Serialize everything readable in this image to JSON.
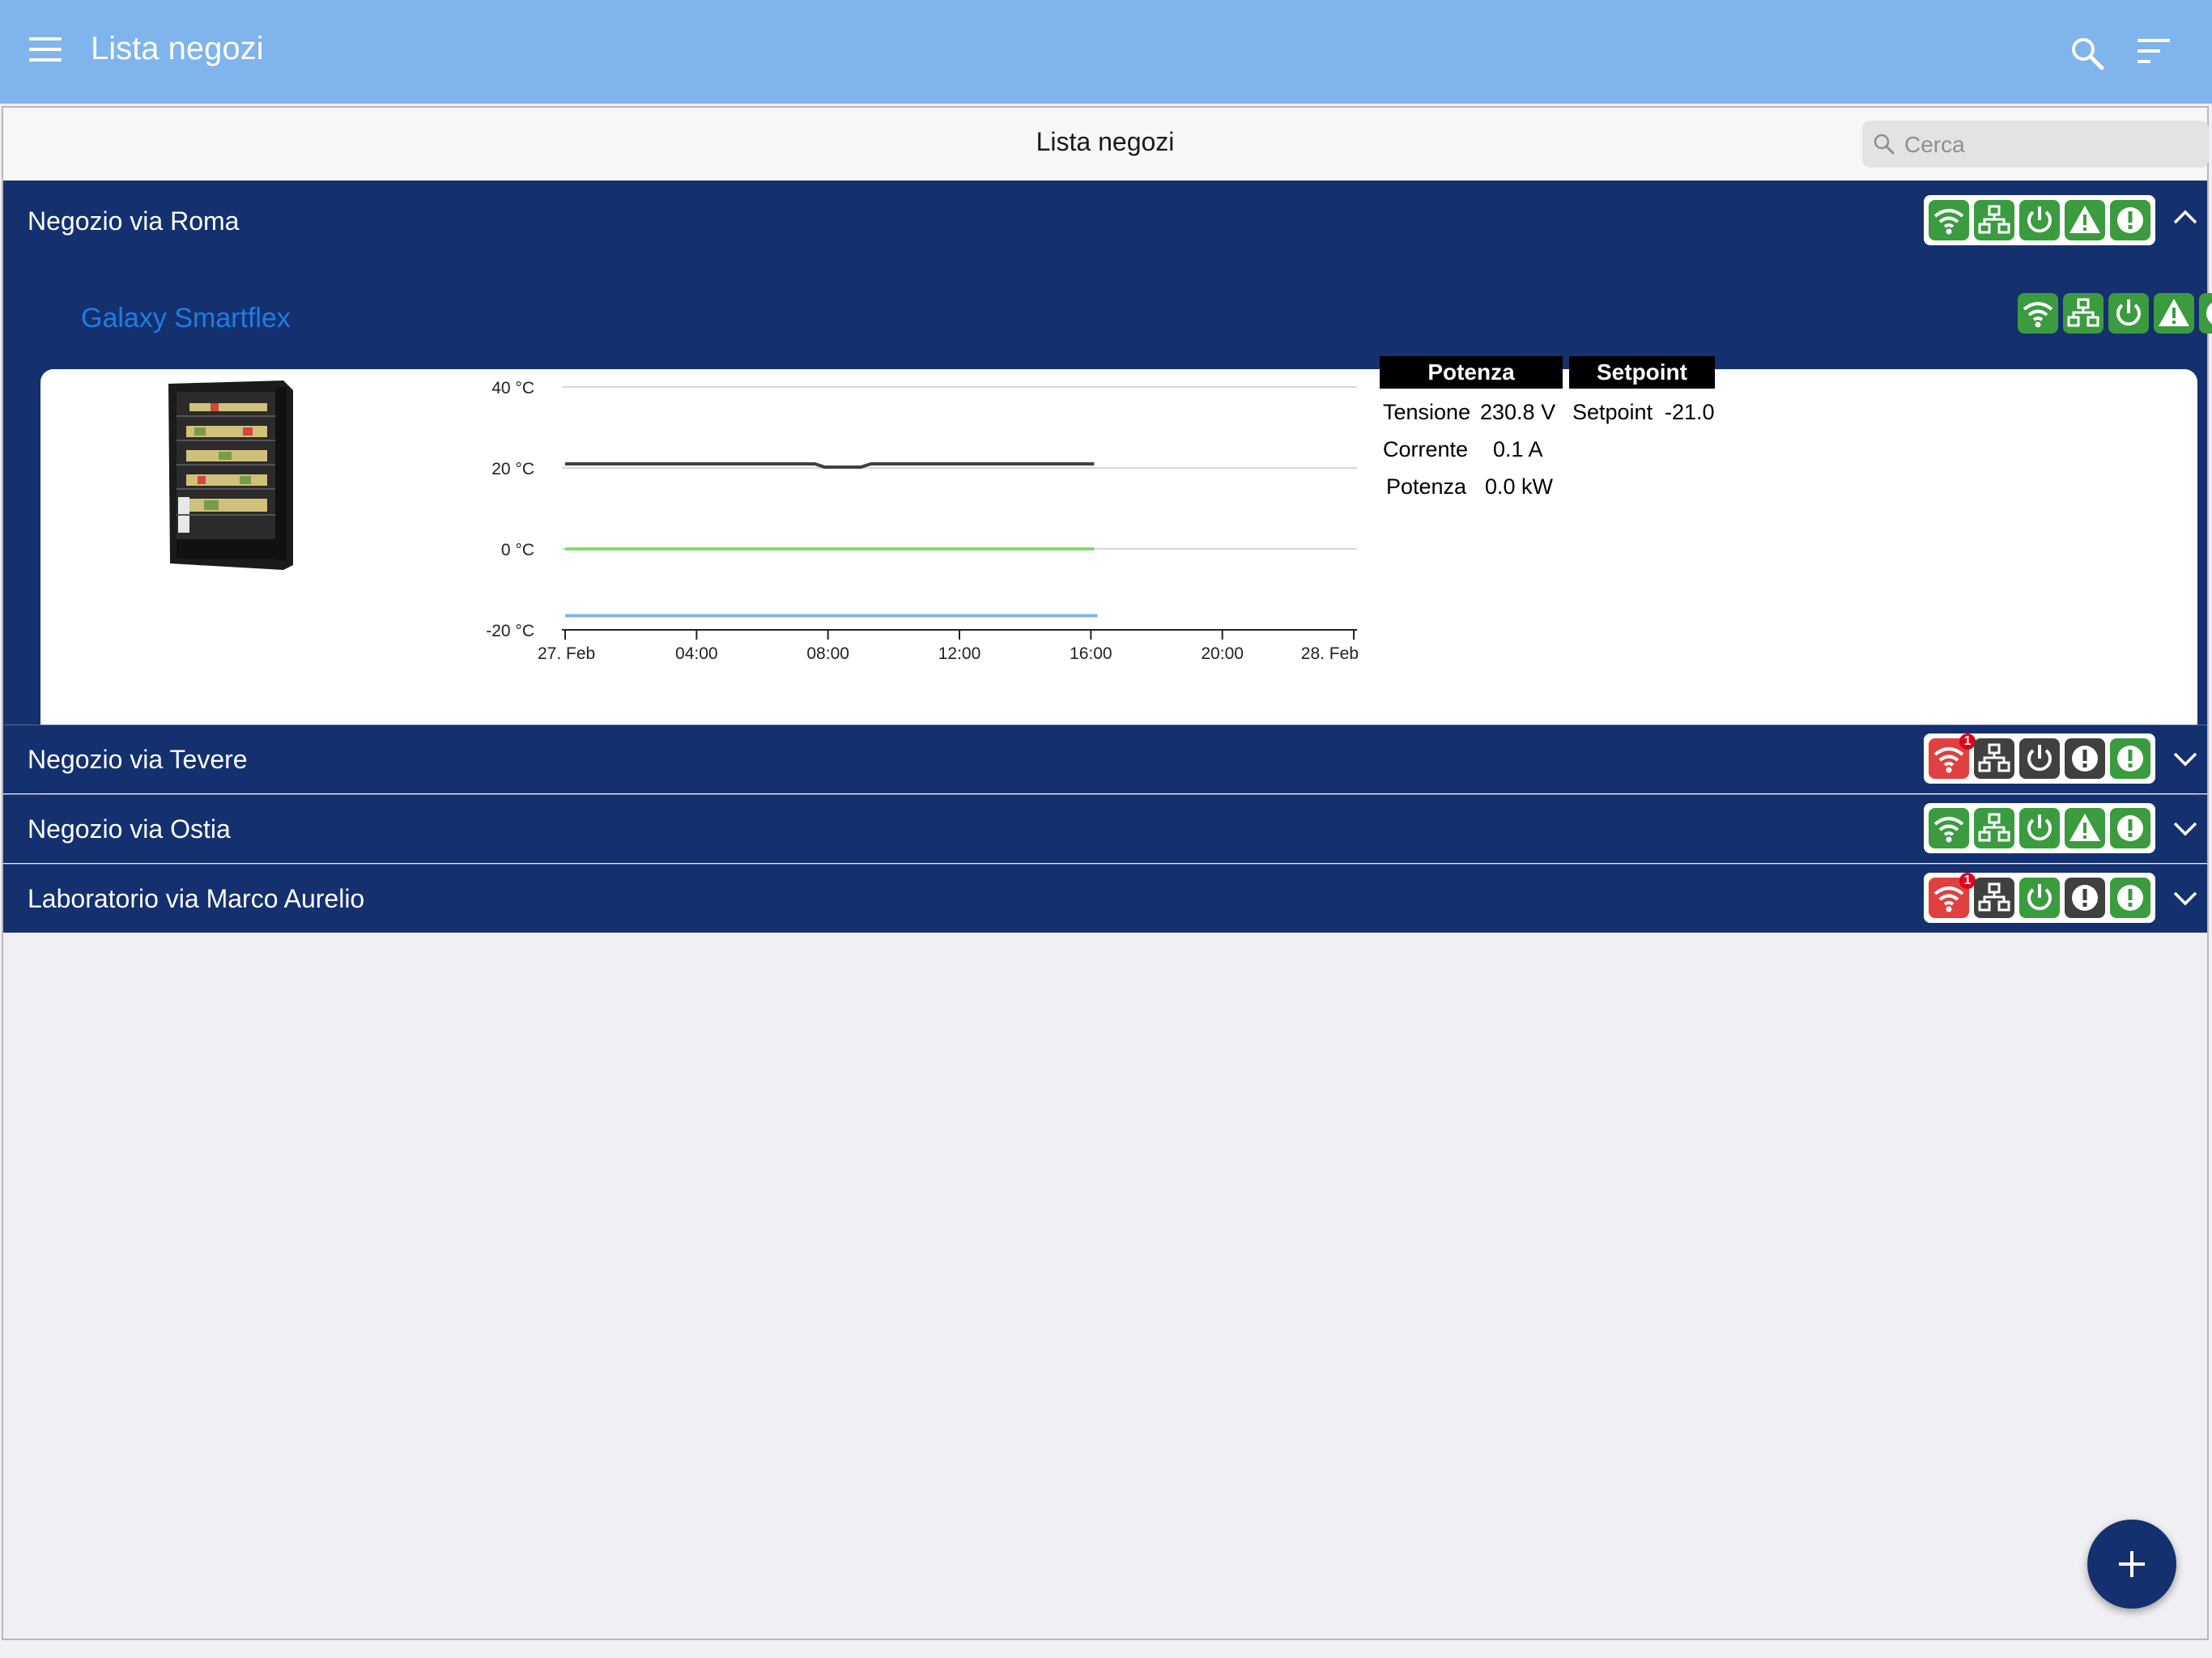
{
  "appbar": {
    "title": "Lista negozi",
    "icons": [
      "menu-icon",
      "search-icon",
      "filter-icon"
    ]
  },
  "subbar": {
    "title": "Lista negozi",
    "search_placeholder": "Cerca"
  },
  "stores": [
    {
      "name": "Negozio via Roma",
      "expanded": true,
      "status": [
        {
          "icon": "wifi-icon",
          "color": "green"
        },
        {
          "icon": "network-icon",
          "color": "green"
        },
        {
          "icon": "power-icon",
          "color": "green"
        },
        {
          "icon": "warning-icon",
          "color": "green"
        },
        {
          "icon": "alert-icon",
          "color": "green"
        }
      ]
    },
    {
      "name": "Negozio via Tevere",
      "expanded": false,
      "status": [
        {
          "icon": "wifi-icon",
          "color": "red",
          "badge": "1"
        },
        {
          "icon": "network-icon",
          "color": "dark"
        },
        {
          "icon": "power-icon",
          "color": "dark"
        },
        {
          "icon": "alert-icon",
          "color": "dark"
        },
        {
          "icon": "alert-icon",
          "color": "green"
        }
      ]
    },
    {
      "name": "Negozio via Ostia",
      "expanded": false,
      "status": [
        {
          "icon": "wifi-icon",
          "color": "green"
        },
        {
          "icon": "network-icon",
          "color": "green"
        },
        {
          "icon": "power-icon",
          "color": "green"
        },
        {
          "icon": "warning-icon",
          "color": "green"
        },
        {
          "icon": "alert-icon",
          "color": "green"
        }
      ]
    },
    {
      "name": "Laboratorio via Marco Aurelio",
      "expanded": false,
      "status": [
        {
          "icon": "wifi-icon",
          "color": "red",
          "badge": "1"
        },
        {
          "icon": "network-icon",
          "color": "dark"
        },
        {
          "icon": "power-icon",
          "color": "green"
        },
        {
          "icon": "alert-icon",
          "color": "dark"
        },
        {
          "icon": "alert-icon",
          "color": "green"
        }
      ]
    }
  ],
  "device": {
    "name": "Galaxy Smartflex",
    "image": "display-fridge-image",
    "status": [
      {
        "icon": "wifi-icon",
        "color": "green"
      },
      {
        "icon": "network-icon",
        "color": "green"
      },
      {
        "icon": "power-icon",
        "color": "green"
      },
      {
        "icon": "warning-icon",
        "color": "green"
      },
      {
        "icon": "alert-icon",
        "color": "green"
      }
    ],
    "readout": {
      "headers": [
        "Potenza",
        "Setpoint"
      ],
      "rows": [
        {
          "label": "Tensione",
          "value": "230.8 V"
        },
        {
          "label": "Corrente",
          "value": "0.1 A"
        },
        {
          "label": "Potenza",
          "value": "0.0 kW"
        }
      ],
      "setpoint_label": "Setpoint",
      "setpoint_value": "-21.0"
    }
  },
  "chart_data": {
    "type": "line",
    "xlabel": "",
    "ylabel": "",
    "ylim": [
      -20,
      40
    ],
    "yticks": [
      "40 °C",
      "20 °C",
      "0 °C",
      "-20 °C"
    ],
    "ytick_values": [
      40,
      20,
      0,
      -20
    ],
    "xlim": [
      "27. Feb 00:00",
      "28. Feb 00:00"
    ],
    "xticks": [
      "27. Feb",
      "04:00",
      "08:00",
      "12:00",
      "16:00",
      "20:00",
      "28. Feb"
    ],
    "xtick_hours": [
      0,
      4,
      8,
      12,
      16,
      20,
      24
    ],
    "grid": true,
    "series": [
      {
        "color": "#404040",
        "x_hours": [
          0,
          7.6,
          7.9,
          9.0,
          9.3,
          16.1
        ],
        "values": [
          21,
          21,
          20.2,
          20.2,
          21,
          21
        ]
      },
      {
        "color": "#7fdc6a",
        "x_hours": [
          0,
          16.1
        ],
        "values": [
          0,
          0
        ]
      },
      {
        "color": "#7fb4ec",
        "x_hours": [
          0,
          16.2
        ],
        "values": [
          -16.5,
          -16.5
        ]
      }
    ]
  },
  "fab": {
    "icon": "plus-icon"
  },
  "colors": {
    "appbar": "#7fb4ec",
    "store_row": "#14306e",
    "status_green": "#3b9b3f",
    "status_red": "#e04040",
    "status_dark": "#404040",
    "device_link": "#1e7de0"
  }
}
